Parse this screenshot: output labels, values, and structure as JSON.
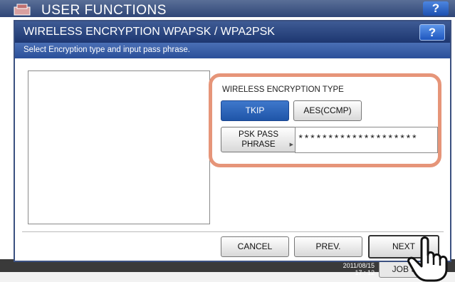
{
  "background": {
    "title": "USER FUNCTIONS",
    "help_label": "?",
    "clock_top": "2011/08/15",
    "clock_time": "17 : 12",
    "job_status_label": "JOB S"
  },
  "dialog": {
    "title": "WIRELESS ENCRYPTION WPAPSK / WPA2PSK",
    "help_label": "?",
    "message": "Select Encryption type and input pass phrase."
  },
  "encryption": {
    "section_label": "WIRELESS ENCRYPTION TYPE",
    "options": [
      {
        "label": "TKIP",
        "selected": true
      },
      {
        "label": "AES(CCMP)",
        "selected": false
      }
    ],
    "psk_button_line1": "PSK PASS",
    "psk_button_line2": "PHRASE",
    "psk_value": "********************"
  },
  "footer": {
    "cancel_label": "CANCEL",
    "prev_label": "PREV.",
    "next_label": "NEXT"
  },
  "colors": {
    "titlebar": "#1d3670",
    "highlight": "#e69579",
    "selected": "#1f55a8"
  },
  "icons": {
    "app_icon": "user-functions-icon",
    "pointer": "hand-pointer-icon"
  }
}
